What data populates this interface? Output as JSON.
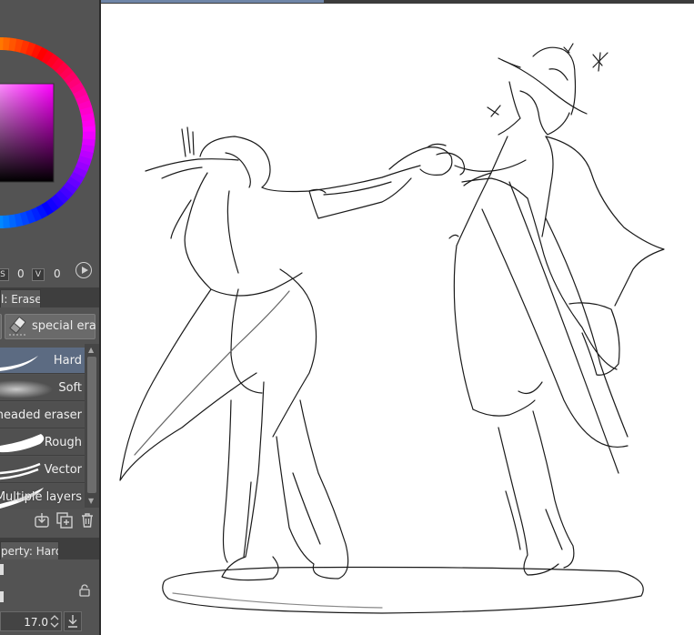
{
  "color_panel": {
    "hsv_labels": [
      "S",
      "V"
    ],
    "hsv_values": [
      "0",
      "0"
    ]
  },
  "tool_tab": {
    "label": "l: Eraser"
  },
  "subtool_group": {
    "label": "special era"
  },
  "brush_list": [
    {
      "label": "Hard",
      "selected": true
    },
    {
      "label": "Soft",
      "selected": false
    },
    {
      "label": "neaded eraser",
      "selected": false
    },
    {
      "label": "Rough",
      "selected": false
    },
    {
      "label": "Vector",
      "selected": false
    },
    {
      "label": "Multiple layers",
      "selected": false
    }
  ],
  "property_tab": {
    "label": "perty: Hard"
  },
  "brush_size": {
    "value": "17.0"
  },
  "icons": [
    "play-circle-icon",
    "eraser-icon",
    "import-icon",
    "duplicate-icon",
    "trash-icon",
    "lock-icon",
    "spinner-icon",
    "download-icon"
  ],
  "colors": {
    "panel": "#535353",
    "selected_item": "#5c6b82",
    "canvas": "#ffffff",
    "tab_highlight": "#6f86a8"
  }
}
